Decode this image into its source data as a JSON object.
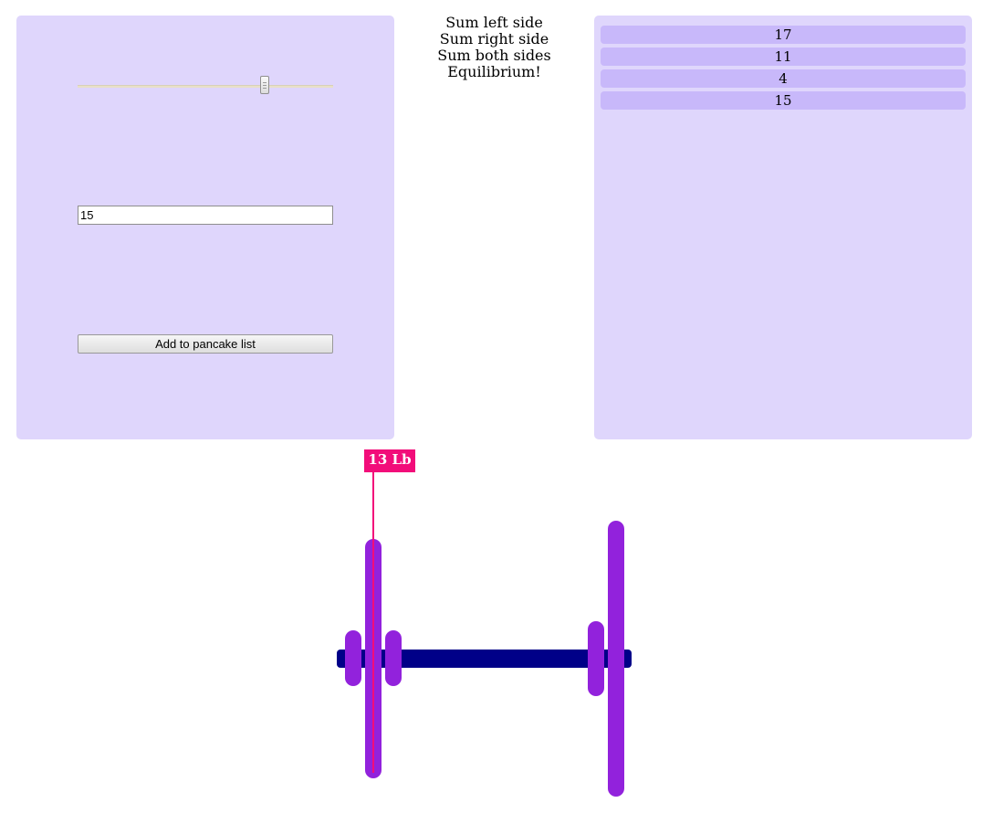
{
  "controls": {
    "slider_value": 0.74,
    "pancake_input_value": "15",
    "add_button_label": "Add to pancake list"
  },
  "sums": {
    "left_label": "Sum left side",
    "right_label": "Sum right side",
    "both_label": "Sum both sides",
    "status": "Equilibrium!"
  },
  "pancake_list": [
    "17",
    "11",
    "4",
    "15"
  ],
  "barbell": {
    "weight_tag": "13 Lb",
    "colors": {
      "bar": "#000088",
      "plate": "#9222dc",
      "tag": "#f20d7a",
      "panel": "#dfd6fc",
      "list_item": "#c8b8fa"
    }
  }
}
